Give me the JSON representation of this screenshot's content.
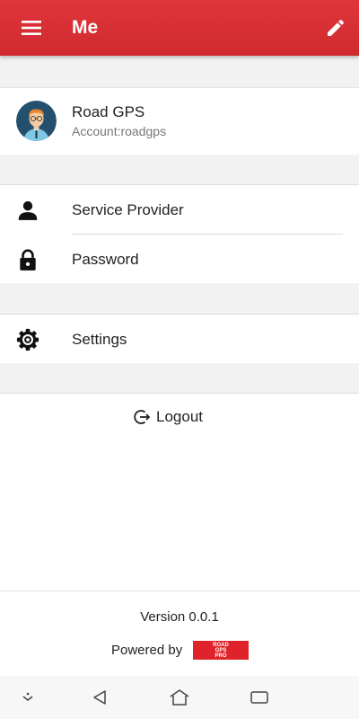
{
  "appbar": {
    "title": "Me",
    "menu_icon": "hamburger-menu-icon",
    "edit_icon": "pencil-icon"
  },
  "profile": {
    "name": "Road GPS",
    "account": "Account:roadgps",
    "avatar_icon": "user-avatar"
  },
  "items": [
    {
      "label": "Service Provider",
      "icon": "person-icon"
    },
    {
      "label": "Password",
      "icon": "lock-icon"
    },
    {
      "label": "Settings",
      "icon": "gear-icon"
    }
  ],
  "logout": {
    "label": "Logout",
    "icon": "logout-icon"
  },
  "footer": {
    "version": "Version 0.0.1",
    "powered_by": "Powered by",
    "logo_text": "ROAD GPS PRO"
  },
  "navbar": {
    "icons": [
      "collapse-down-icon",
      "back-icon",
      "home-icon",
      "recents-icon"
    ]
  },
  "colors": {
    "accent": "#d52e33",
    "logo_red": "#e0232a",
    "background": "#f2f2f2"
  }
}
